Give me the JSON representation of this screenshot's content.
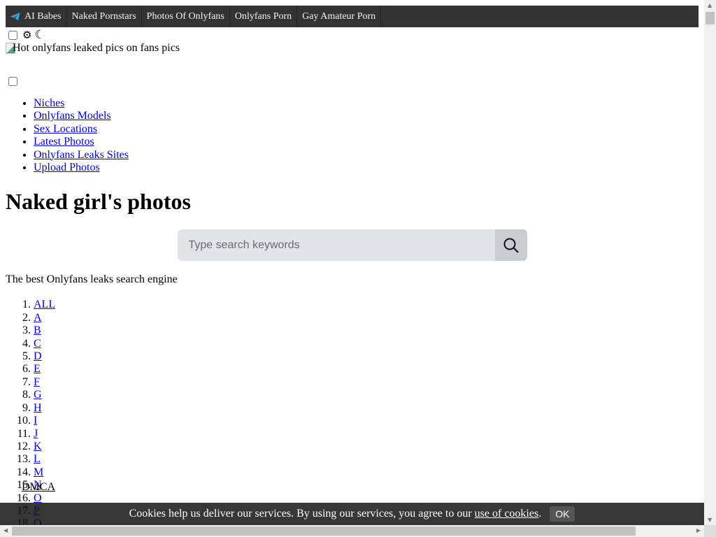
{
  "topnav": {
    "items": [
      {
        "label": "AI Babes",
        "icon": "telegram-icon"
      },
      {
        "label": "Naked Pornstars"
      },
      {
        "label": "Photos Of Onlyfans"
      },
      {
        "label": "Onlyfans Porn"
      },
      {
        "label": "Gay Amateur Porn"
      }
    ]
  },
  "theme": {
    "light_icon": "sun-gear-icon",
    "dark_icon": "moon-icon"
  },
  "logo": {
    "alt": "Hot onlyfans leaked pics on fans pics"
  },
  "menu": {
    "items": [
      "Niches",
      "Onlyfans Models",
      "Sex Locations",
      "Latest Photos",
      "Onlyfans Leaks Sites",
      "Upload Photos"
    ]
  },
  "page_title": "Naked girl's photos",
  "search": {
    "placeholder": "Type search keywords",
    "icon": "search-icon"
  },
  "tagline": "The best Onlyfans leaks search engine",
  "alphabet": [
    "ALL",
    "A",
    "B",
    "C",
    "D",
    "E",
    "F",
    "G",
    "H",
    "I",
    "J",
    "K",
    "L",
    "M",
    "N",
    "O",
    "P",
    "Q"
  ],
  "footer": {
    "dmca": "DMCA"
  },
  "cookie": {
    "text": "Cookies help us deliver our services. By using our services, you agree to our",
    "link": "use of cookies",
    "period": ".",
    "ok": "OK"
  }
}
